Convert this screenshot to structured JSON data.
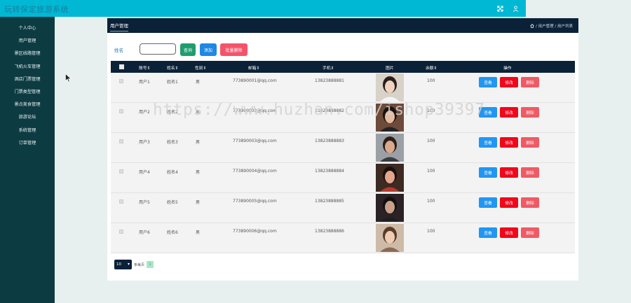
{
  "app": {
    "title": "玩转保定旅游系统"
  },
  "topbar": {
    "icons": [
      "expand-icon",
      "user-icon"
    ]
  },
  "sidebar": {
    "items": [
      {
        "label": "个人中心"
      },
      {
        "label": "用户管理"
      },
      {
        "label": "景区线路管理"
      },
      {
        "label": "飞机火车管理"
      },
      {
        "label": "酒店门票管理"
      },
      {
        "label": "门票类型管理"
      },
      {
        "label": "景点美食管理"
      },
      {
        "label": "旅游论坛"
      },
      {
        "label": "系统管理"
      },
      {
        "label": "订单管理"
      }
    ]
  },
  "panel": {
    "tab": "用户管理",
    "breadcrumb": "/ 用户管理 / 用户列表",
    "home_icon": "home-icon"
  },
  "filters": {
    "name_label": "姓名",
    "name_value": "",
    "search_label": "查询",
    "add_label": "添加",
    "batch_delete_label": "批量删除"
  },
  "table": {
    "headers": [
      "账号⇕",
      "姓名⇕",
      "性别⇕",
      "邮箱⇕",
      "手机⇕",
      "图片",
      "余额⇕",
      "操作"
    ],
    "rows": [
      {
        "account": "用户1",
        "name": "姓名1",
        "gender": "男",
        "email": "773890001@qq.com",
        "phone": "13823888881",
        "balance": "100"
      },
      {
        "account": "用户2",
        "name": "姓名2",
        "gender": "男",
        "email": "773890002@qq.com",
        "phone": "13823888882",
        "balance": "100"
      },
      {
        "account": "用户3",
        "name": "姓名3",
        "gender": "男",
        "email": "773890003@qq.com",
        "phone": "13823888883",
        "balance": "100"
      },
      {
        "account": "用户4",
        "name": "姓名4",
        "gender": "男",
        "email": "773890004@qq.com",
        "phone": "13823888884",
        "balance": "100"
      },
      {
        "account": "用户5",
        "name": "姓名5",
        "gender": "男",
        "email": "773890005@qq.com",
        "phone": "13823888885",
        "balance": "100"
      },
      {
        "account": "用户6",
        "name": "姓名6",
        "gender": "男",
        "email": "773890006@qq.com",
        "phone": "13823888886",
        "balance": "100"
      }
    ],
    "actions": {
      "view": "查看",
      "edit": "修改",
      "delete": "删除"
    }
  },
  "pager": {
    "page_size": "10",
    "text": "条每页",
    "current": "1"
  },
  "watermark": "https://www.huzhan.com/ishop39397",
  "colors": {
    "topbar": "#00b8d4",
    "sidebar": "#0d3b42",
    "header": "#0b2138",
    "search": "#1e9e6f",
    "add": "#1e88e5",
    "batch_delete": "#f5536b",
    "view": "#2196f3",
    "edit": "#f0071b",
    "delete": "#f05a64"
  }
}
